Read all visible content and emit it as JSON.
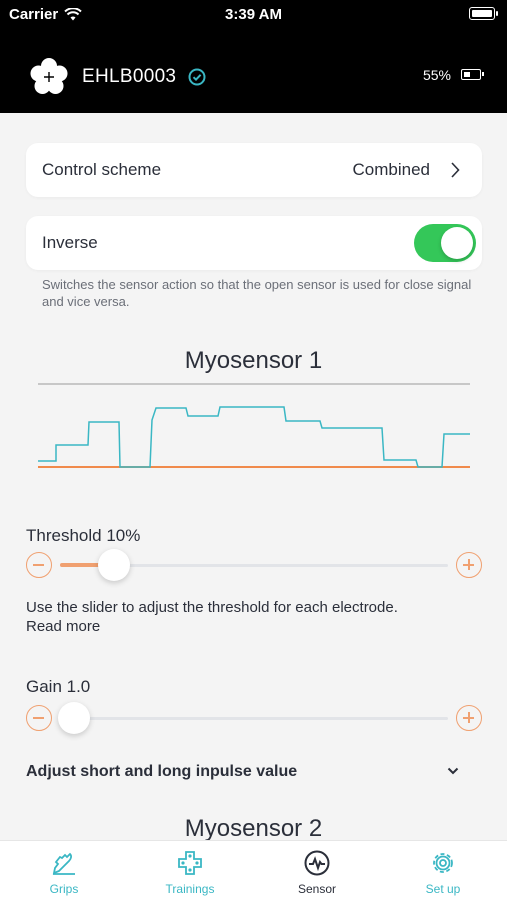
{
  "status_bar": {
    "carrier": "Carrier",
    "time": "3:39 AM"
  },
  "header": {
    "device_name": "EHLB0003",
    "battery": "55%",
    "battery_level": 0.55,
    "verified": true
  },
  "settings": {
    "control_scheme": {
      "label": "Control scheme",
      "value": "Combined"
    },
    "inverse": {
      "label": "Inverse",
      "enabled": true,
      "hint": "Switches the sensor action so that the open sensor is used for close signal and vice versa."
    }
  },
  "sensor1": {
    "title": "Myosensor 1",
    "threshold_label": "Threshold 10%",
    "threshold": 0.1,
    "description": "Use the slider to adjust the threshold for each electrode.",
    "read_more": "Read more",
    "gain_label": "Gain 1.0",
    "gain": 1.0,
    "expand_label": "Adjust short and long inpulse value"
  },
  "sensor2": {
    "title": "Myosensor 2"
  },
  "tabs": [
    {
      "label": "Grips",
      "icon": "grip-hand-icon",
      "active": false
    },
    {
      "label": "Trainings",
      "icon": "gamepad-icon",
      "active": false
    },
    {
      "label": "Sensor",
      "icon": "pulse-icon",
      "active": true
    },
    {
      "label": "Set up",
      "icon": "gear-icon",
      "active": false
    }
  ],
  "colors": {
    "accent": "#3ab7c4",
    "orange": "#f0a070",
    "toggle_on": "#34c759",
    "header_bg": "#000000"
  }
}
